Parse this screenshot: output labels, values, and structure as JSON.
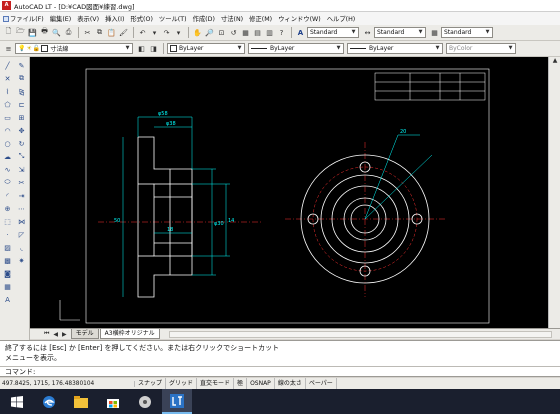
{
  "window": {
    "app_icon_text": "A",
    "title": "AutoCAD LT - [D:¥CAD図面¥練習.dwg]"
  },
  "menu": [
    {
      "label": "ファイル(F)"
    },
    {
      "label": "編集(E)"
    },
    {
      "label": "表示(V)"
    },
    {
      "label": "挿入(I)"
    },
    {
      "label": "形式(O)"
    },
    {
      "label": "ツール(T)"
    },
    {
      "label": "作成(D)"
    },
    {
      "label": "寸法(N)"
    },
    {
      "label": "修正(M)"
    },
    {
      "label": "ウィンドウ(W)"
    },
    {
      "label": "ヘルプ(H)"
    }
  ],
  "toolbar": {
    "text_style": "Standard",
    "dim_style": "Standard",
    "table_style": "Standard",
    "layer": "寸法線",
    "color": "ByLayer",
    "linetype": "ByLayer",
    "lineweight": "ByLayer",
    "plot_style": "ByColor"
  },
  "tabs": {
    "model": "モデル",
    "layout": "A3横枠オリジナル"
  },
  "command": {
    "history": [
      "終了するには [Esc] か [Enter] を押してください。または右クリックでショートカット",
      "メニューを表示。"
    ],
    "prompt": "コマンド:"
  },
  "status": {
    "coordinates": "497.8425, 1715, 176.48380104",
    "buttons": [
      "スナップ",
      "グリッド",
      "直交モード",
      "極",
      "OSNAP",
      "線の太さ",
      "ペーパー"
    ]
  },
  "drawing": {
    "dim_labels": [
      "φ58",
      "φ38",
      "φ30",
      "14",
      "18",
      "50",
      "20"
    ]
  },
  "colors": {
    "canvas": "#000000",
    "line_white": "#ffffff",
    "line_cyan": "#00ffff",
    "line_red": "#ff3030",
    "taskbar": "#1a1f2e"
  }
}
